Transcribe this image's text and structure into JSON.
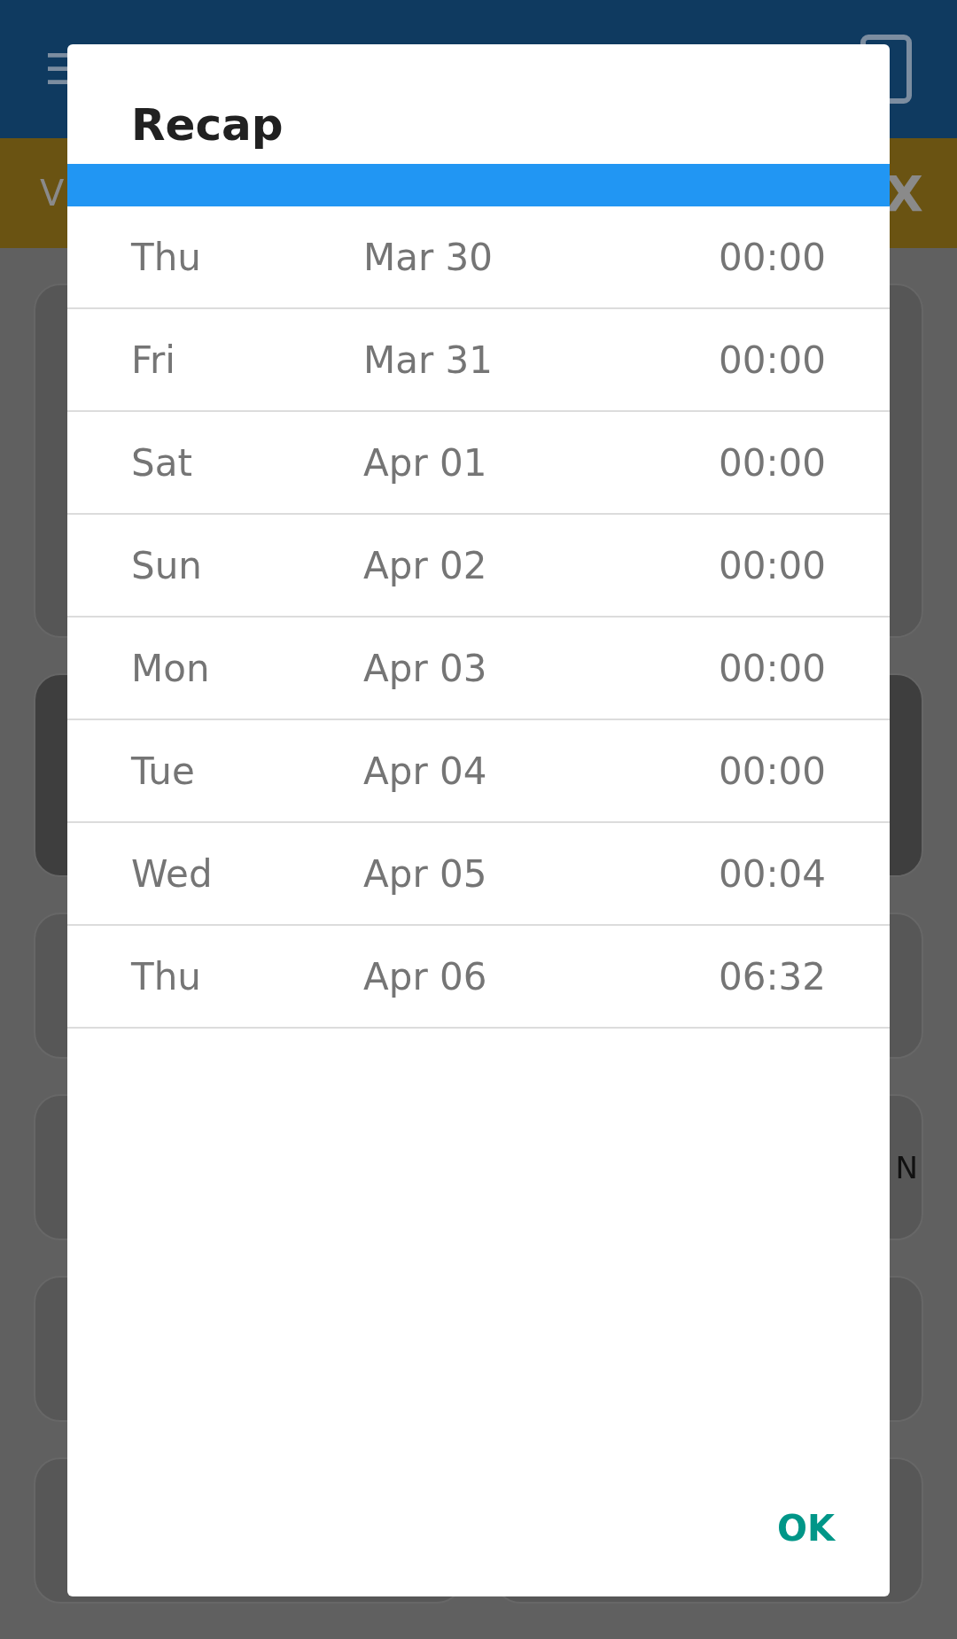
{
  "app_bar": {
    "menu_icon": "☰"
  },
  "banner": {
    "left_text": "V",
    "right_text": "X"
  },
  "background_card": {
    "text": "N"
  },
  "dialog": {
    "title": "Recap",
    "rows": [
      {
        "day": "Thu",
        "date": "Mar 30",
        "time": "00:00"
      },
      {
        "day": "Fri",
        "date": "Mar 31",
        "time": "00:00"
      },
      {
        "day": "Sat",
        "date": "Apr 01",
        "time": "00:00"
      },
      {
        "day": "Sun",
        "date": "Apr 02",
        "time": "00:00"
      },
      {
        "day": "Mon",
        "date": "Apr 03",
        "time": "00:00"
      },
      {
        "day": "Tue",
        "date": "Apr 04",
        "time": "00:00"
      },
      {
        "day": "Wed",
        "date": "Apr 05",
        "time": "00:04"
      },
      {
        "day": "Thu",
        "date": "Apr 06",
        "time": "06:32"
      }
    ],
    "button": "OK"
  }
}
